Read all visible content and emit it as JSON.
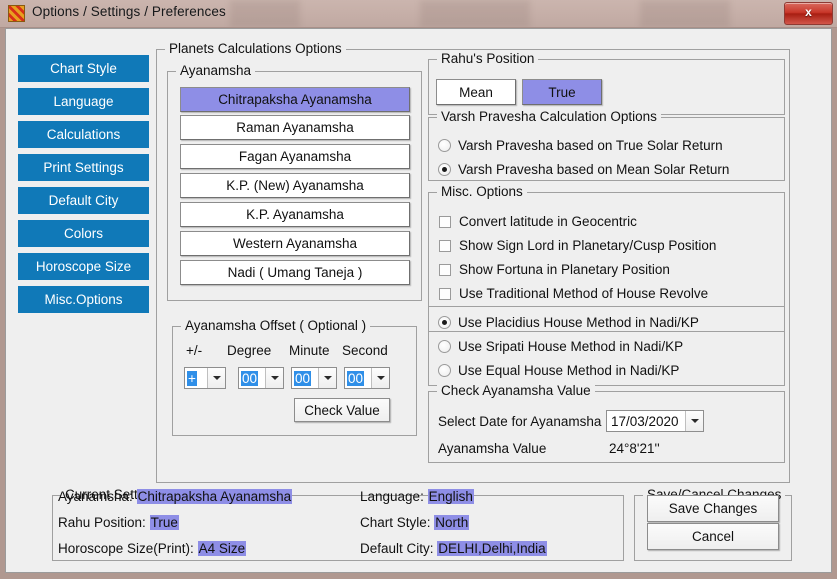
{
  "window": {
    "title": "Options / Settings / Preferences",
    "app_icon": "checkered-grid-icon",
    "close_label": "x",
    "accent_blue": "#1079b8",
    "selection_purple": "#8e8ee6",
    "selection_blue": "#2f8fe8"
  },
  "sidebar": {
    "items": [
      {
        "label": "Chart Style"
      },
      {
        "label": "Language"
      },
      {
        "label": "Calculations"
      },
      {
        "label": "Print Settings"
      },
      {
        "label": "Default City"
      },
      {
        "label": "Colors"
      },
      {
        "label": "Horoscope Size"
      },
      {
        "label": "Misc.Options"
      }
    ]
  },
  "planets_group": {
    "title": "Planets Calculations Options",
    "ayanamsha": {
      "title": "Ayanamsha",
      "selected": "Chitrapaksha Ayanamsha",
      "options": [
        {
          "label": "Chitrapaksha Ayanamsha",
          "selected": true
        },
        {
          "label": "Raman Ayanamsha",
          "selected": false
        },
        {
          "label": "Fagan Ayanamsha",
          "selected": false
        },
        {
          "label": "K.P. (New) Ayanamsha",
          "selected": false
        },
        {
          "label": "K.P. Ayanamsha",
          "selected": false
        },
        {
          "label": "Western Ayanamsha",
          "selected": false
        },
        {
          "label": "Nadi ( Umang Taneja )",
          "selected": false
        }
      ]
    },
    "offset": {
      "title": "Ayanamsha Offset ( Optional )",
      "col_sign": "+/-",
      "col_degree": "Degree",
      "col_minute": "Minute",
      "col_second": "Second",
      "sign_value": "+",
      "degree_value": "00",
      "minute_value": "00",
      "second_value": "00",
      "check_value_label": "Check Value"
    }
  },
  "rahu": {
    "title": "Rahu's Position",
    "mean_label": "Mean",
    "true_label": "True",
    "selected": "True"
  },
  "varsh": {
    "title": "Varsh Pravesha Calculation Options",
    "options": [
      {
        "label": "Varsh Pravesha based on True Solar Return",
        "selected": false
      },
      {
        "label": "Varsh Pravesha based on Mean Solar Return",
        "selected": true
      }
    ]
  },
  "misc": {
    "title": "Misc. Options",
    "options": [
      {
        "label": "Convert latitude in Geocentric",
        "checked": false
      },
      {
        "label": "Show Sign Lord in Planetary/Cusp Position",
        "checked": false
      },
      {
        "label": "Show Fortuna in Planetary Position",
        "checked": false
      },
      {
        "label": "Use Traditional Method of House Revolve",
        "checked": false
      }
    ]
  },
  "house_method": {
    "options": [
      {
        "label": "Use Placidius House Method in Nadi/KP",
        "selected": true
      },
      {
        "label": "Use Sripati House Method in Nadi/KP",
        "selected": false
      },
      {
        "label": "Use Equal House Method in Nadi/KP",
        "selected": false
      }
    ]
  },
  "check_ayanamsha": {
    "title": "Check Ayanamsha Value",
    "date_label": "Select Date for Ayanamsha",
    "date_value": "17/03/2020",
    "value_label": "Ayanamsha Value",
    "value": "24°8'21''"
  },
  "current_settings": {
    "title": "Current Settings",
    "rows_left": [
      {
        "label": "Ayanamsha:",
        "value": "Chitrapaksha Ayanamsha"
      },
      {
        "label": "Rahu Position:",
        "value": "True"
      },
      {
        "label": "Horoscope Size(Print):",
        "value": "A4 Size"
      }
    ],
    "rows_right": [
      {
        "label": "Language:",
        "value": "English"
      },
      {
        "label": "Chart Style:",
        "value": "North"
      },
      {
        "label": "Default City:",
        "value": "DELHI,Delhi,India"
      }
    ]
  },
  "save_cancel": {
    "title": "Save/Cancel Changes",
    "save_label": "Save Changes",
    "cancel_label": "Cancel"
  }
}
